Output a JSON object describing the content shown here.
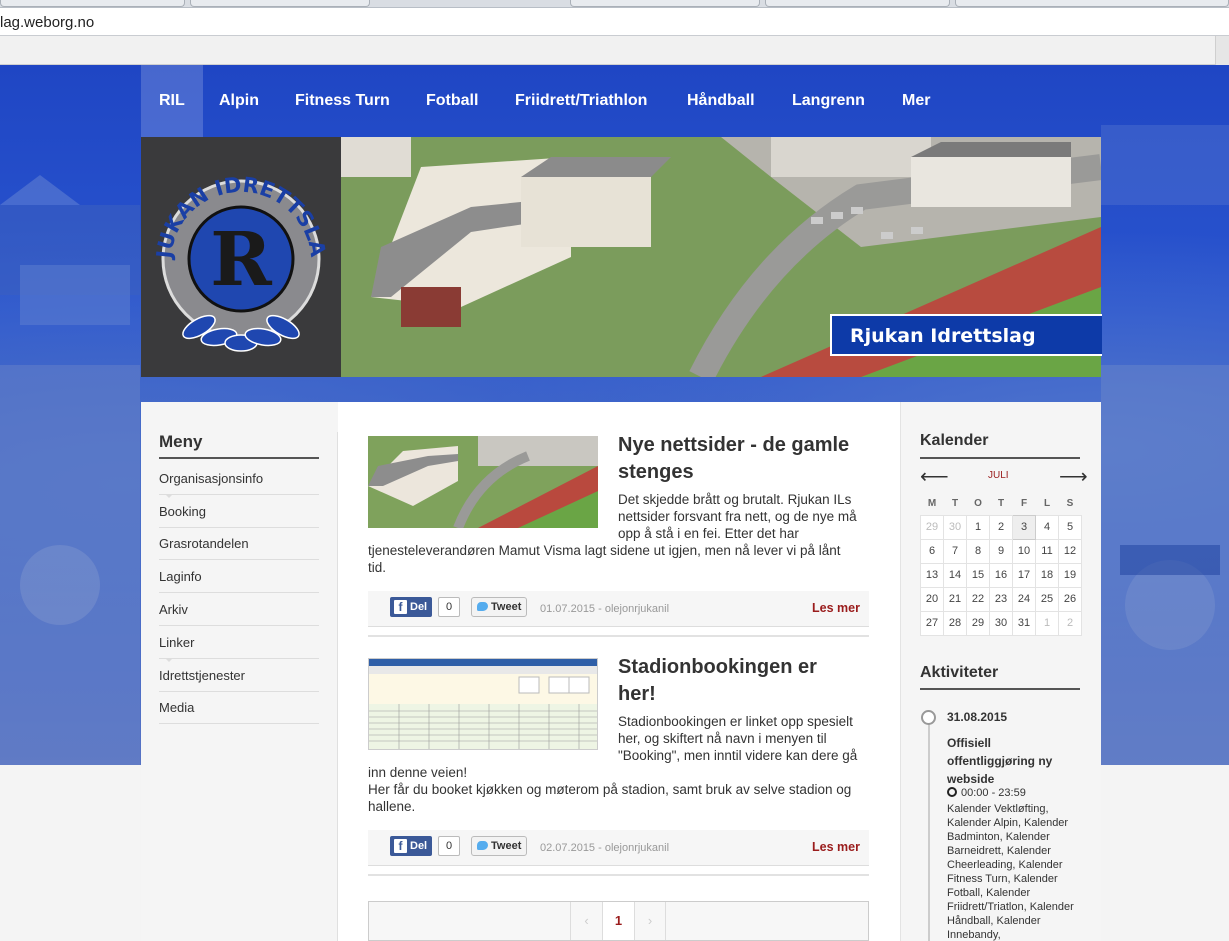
{
  "browser": {
    "address": "lag.weborg.no"
  },
  "nav": {
    "items": [
      "RIL",
      "Alpin",
      "Fitness Turn",
      "Fotball",
      "Friidrett/Triathlon",
      "Håndball",
      "Langrenn",
      "Mer"
    ]
  },
  "hero": {
    "caption": "Rjukan Idrettslag",
    "logo_text": "RJUKAN IDRETTSLAG",
    "logo_letter": "R"
  },
  "sidebar": {
    "heading": "Meny",
    "items": [
      "Organisasjonsinfo",
      "Booking",
      "Grasrotandelen",
      "Laginfo",
      "Arkiv",
      "Linker",
      "Idrettstjenester",
      "Media"
    ]
  },
  "posts": [
    {
      "title_line1": "Nye nettsider - de gamle",
      "title_line2": "stenges",
      "text_narrow": [
        "Det skjedde brått og brutalt. Rjukan ILs",
        "nettsider forsvant fra nett, og de nye må",
        "opp å stå i en fei. Etter det har"
      ],
      "text_wide": [
        "tjenesteleverandøren Mamut Visma lagt sidene ut igjen, men nå lever vi på lånt",
        "tid."
      ],
      "share": {
        "fb_label": "Del",
        "fb_count": "0",
        "tweet_label": "Tweet"
      },
      "date": "01.07.2015",
      "author": "- olejonrjukanil",
      "more": "Les mer"
    },
    {
      "title_line1": "Stadionbookingen er",
      "title_line2": "her!",
      "text_narrow": [
        "Stadionbookingen er linket opp spesielt",
        "her, og skiftert nå navn i menyen til",
        "\"Booking\", men inntil videre kan dere gå"
      ],
      "text_wide": [
        "inn denne veien!",
        "Her får du booket kjøkken og møterom på stadion, samt bruk av selve stadion og",
        "hallene."
      ],
      "share": {
        "fb_label": "Del",
        "fb_count": "0",
        "tweet_label": "Tweet"
      },
      "date": "02.07.2015",
      "author": "- olejonrjukanil",
      "more": "Les mer"
    }
  ],
  "pager": {
    "prev": "‹",
    "current": "1",
    "next": "›"
  },
  "calendar": {
    "heading": "Kalender",
    "month": "JULI",
    "prev": "⟵",
    "next": "⟶",
    "weekdays": [
      "M",
      "T",
      "O",
      "T",
      "F",
      "L",
      "S"
    ],
    "weeks": [
      [
        "29",
        "30",
        "1",
        "2",
        "3",
        "4",
        "5"
      ],
      [
        "6",
        "7",
        "8",
        "9",
        "10",
        "11",
        "12"
      ],
      [
        "13",
        "14",
        "15",
        "16",
        "17",
        "18",
        "19"
      ],
      [
        "20",
        "21",
        "22",
        "23",
        "24",
        "25",
        "26"
      ],
      [
        "27",
        "28",
        "29",
        "30",
        "31",
        "1",
        "2"
      ]
    ]
  },
  "activities": {
    "heading": "Aktiviteter",
    "date": "31.08.2015",
    "title": "Offisiell offentliggjøring ny webside",
    "time": "00:00 - 23:59",
    "categories": "Kalender Vektløfting, Kalender Alpin, Kalender Badminton, Kalender Barneidrett, Kalender Cheerleading, Kalender Fitness Turn, Kalender Fotball, Kalender Friidrett/Triatlon, Kalender Håndball, Kalender Innebandy,"
  }
}
